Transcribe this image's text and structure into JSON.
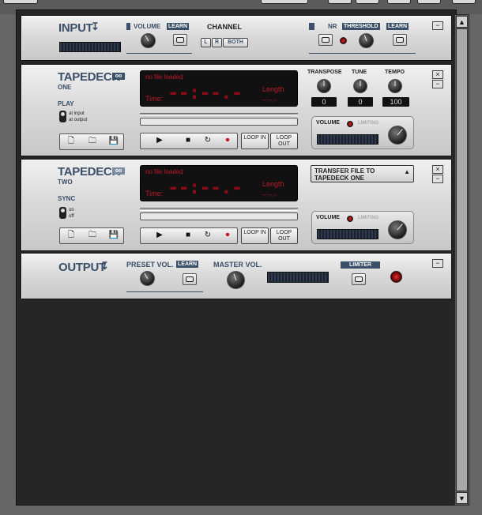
{
  "input": {
    "title": "INPUT",
    "title_icon": "↧",
    "volume_label": "VOLUME",
    "learn": "LEARN",
    "channel_label": "CHANNEL",
    "ch_l": "L",
    "ch_r": "R",
    "ch_both": "BOTH",
    "nr_label": "NR",
    "threshold_label": "THRESHOLD",
    "threshold_learn": "LEARN"
  },
  "tape1": {
    "title": "TAPEDECK",
    "sub": "ONE",
    "play_label": "PLAY",
    "opt1": "at input",
    "opt2": "at output",
    "status": "no file loaded",
    "time_label": "Time:",
    "time_value": "--:--.-",
    "length_label": "Length",
    "length_value": "--:--.-",
    "transpose_label": "TRANSPOSE",
    "tune_label": "TUNE",
    "tempo_label": "TEMPO",
    "transpose_value": "0",
    "tune_value": "0",
    "tempo_value": "100",
    "volume_label": "VOLUME",
    "limiting_label": "LIMITING",
    "loop_in": "LOOP IN",
    "loop_out": "LOOP OUT"
  },
  "tape2": {
    "title": "TAPEDECK",
    "sub": "TWO",
    "sync_label": "SYNC",
    "opt1": "on",
    "opt2": "off",
    "status": "no file loaded",
    "time_label": "Time:",
    "time_value": "--:--.-",
    "length_label": "Length",
    "length_value": "--:--.-",
    "transfer_label": "TRANSFER FILE TO TAPEDECK ONE",
    "volume_label": "VOLUME",
    "limiting_label": "LIMITING",
    "loop_in": "LOOP IN",
    "loop_out": "LOOP OUT"
  },
  "output": {
    "title": "OUTPUT",
    "title_icon": "↧",
    "preset_label": "PRESET VOL.",
    "learn": "LEARN",
    "master_label": "MASTER VOL.",
    "limiter_label": "LIMITER"
  },
  "colors": {
    "accent": "#3a4f68",
    "led": "#c0182a"
  }
}
